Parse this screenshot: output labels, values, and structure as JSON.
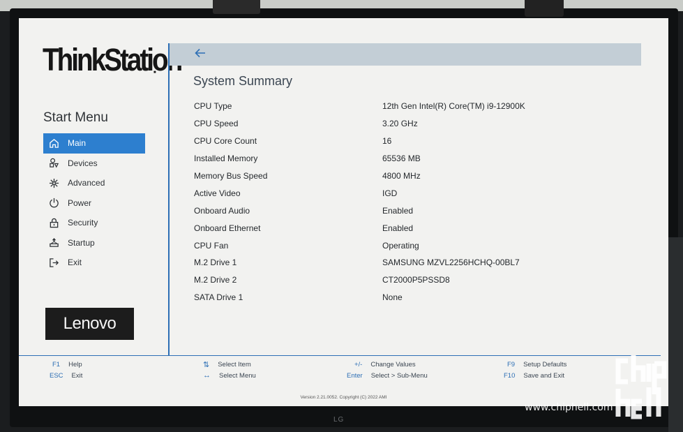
{
  "brand": {
    "name": "ThinkStation",
    "vendor": "Lenovo",
    "monitor_brand": "LG"
  },
  "sidebar": {
    "title": "Start Menu",
    "items": [
      {
        "label": "Main",
        "icon": "home-icon",
        "active": true
      },
      {
        "label": "Devices",
        "icon": "devices-icon",
        "active": false
      },
      {
        "label": "Advanced",
        "icon": "advanced-icon",
        "active": false
      },
      {
        "label": "Power",
        "icon": "power-icon",
        "active": false
      },
      {
        "label": "Security",
        "icon": "lock-icon",
        "active": false
      },
      {
        "label": "Startup",
        "icon": "startup-icon",
        "active": false
      },
      {
        "label": "Exit",
        "icon": "exit-icon",
        "active": false
      }
    ]
  },
  "main": {
    "back_icon": "arrow-left-icon",
    "title": "System Summary",
    "rows": [
      {
        "label": "CPU Type",
        "value": "12th Gen Intel(R) Core(TM) i9-12900K"
      },
      {
        "label": "CPU Speed",
        "value": "3.20 GHz"
      },
      {
        "label": "CPU Core Count",
        "value": "16"
      },
      {
        "label": "Installed Memory",
        "value": "65536 MB"
      },
      {
        "label": "Memory Bus Speed",
        "value": "4800 MHz"
      },
      {
        "label": "Active Video",
        "value": "IGD"
      },
      {
        "label": "Onboard Audio",
        "value": "Enabled"
      },
      {
        "label": "Onboard Ethernet",
        "value": "Enabled"
      },
      {
        "label": "CPU Fan",
        "value": "Operating"
      },
      {
        "label": "M.2 Drive 1",
        "value": "SAMSUNG MZVL2256HCHQ-00BL7"
      },
      {
        "label": "M.2 Drive 2",
        "value": "CT2000P5PSSD8"
      },
      {
        "label": "SATA Drive 1",
        "value": "None"
      }
    ]
  },
  "footer": {
    "f1_key": "F1",
    "f1_label": "Help",
    "esc_key": "ESC",
    "esc_label": "Exit",
    "updown_key": "⇅",
    "updown_label": "Select Item",
    "leftright_key": "↔",
    "leftright_label": "Select Menu",
    "plusminus_key": "+/-",
    "plusminus_label": "Change Values",
    "enter_key": "Enter",
    "enter_label": "Select > Sub-Menu",
    "f9_key": "F9",
    "f9_label": "Setup Defaults",
    "f10_key": "F10",
    "f10_label": "Save and Exit",
    "copyright": "Version 2.21.0052. Copyright (C) 2022 AMI"
  },
  "watermark": {
    "logo": "chip hell",
    "url": "www.chiphell.com"
  },
  "colors": {
    "accent": "#2d7fcf",
    "divider": "#2d6fb5",
    "top_bar": "#c3ced6",
    "screen_bg": "#f2f2f0"
  }
}
